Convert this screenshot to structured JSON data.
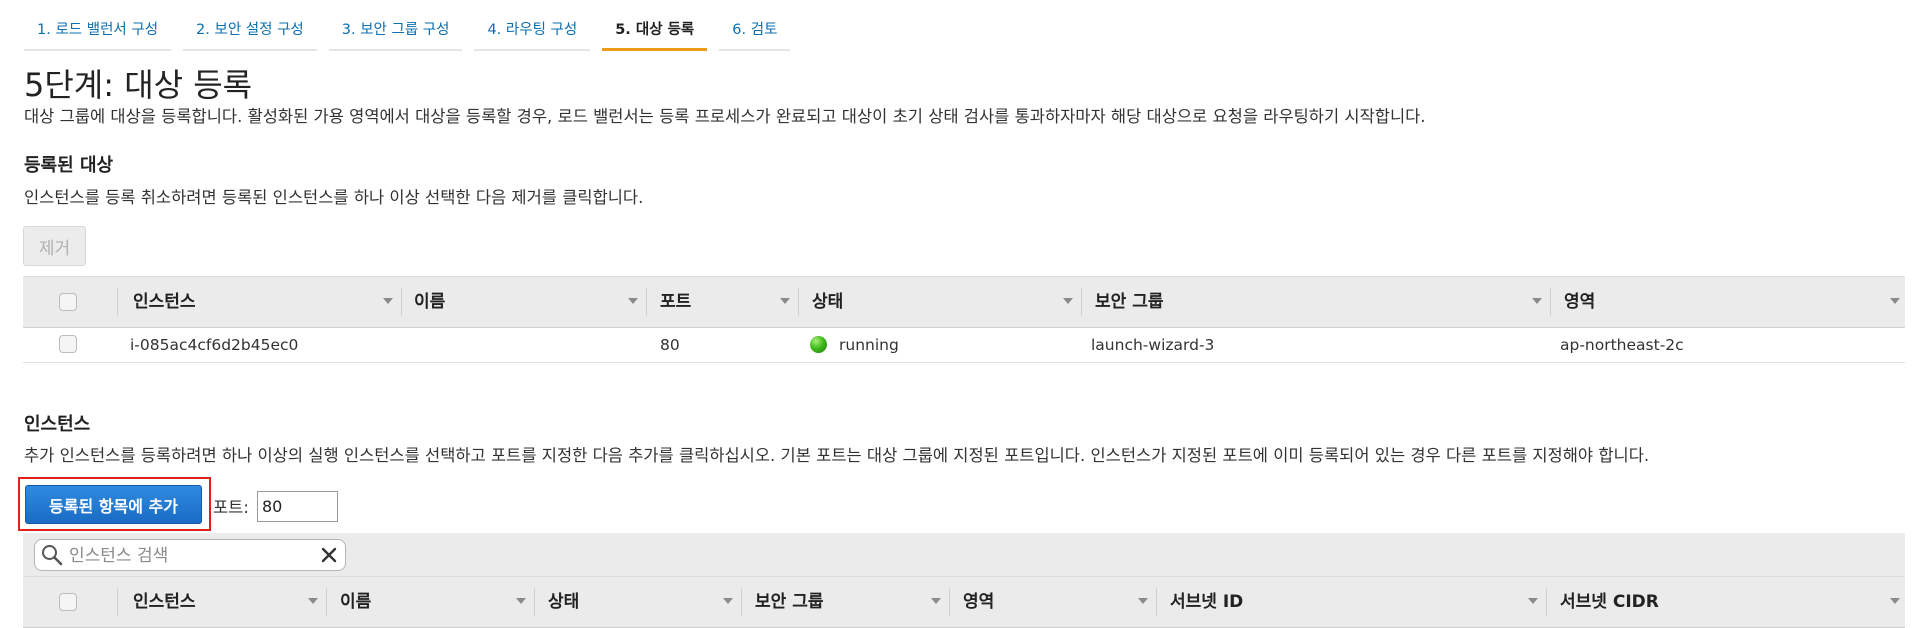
{
  "wizard_tabs": [
    {
      "label": "1. 로드 밸런서 구성",
      "active": false
    },
    {
      "label": "2. 보안 설정 구성",
      "active": false
    },
    {
      "label": "3. 보안 그룹 구성",
      "active": false
    },
    {
      "label": "4. 라우팅 구성",
      "active": false
    },
    {
      "label": "5. 대상 등록",
      "active": true
    },
    {
      "label": "6. 검토",
      "active": false
    }
  ],
  "page": {
    "title": "5단계: 대상 등록",
    "description": "대상 그룹에 대상을 등록합니다. 활성화된 가용 영역에서 대상을 등록할 경우, 로드 밸런서는 등록 프로세스가 완료되고 대상이 초기 상태 검사를 통과하자마자 해당 대상으로 요청을 라우팅하기 시작합니다."
  },
  "registered": {
    "title": "등록된 대상",
    "description": "인스턴스를 등록 취소하려면 등록된 인스턴스를 하나 이상 선택한 다음 제거를 클릭합니다.",
    "remove_label": "제거",
    "columns": [
      "인스턴스",
      "이름",
      "포트",
      "상태",
      "보안 그룹",
      "영역"
    ],
    "rows": [
      {
        "instance": "i-085ac4cf6d2b45ec0",
        "name": "",
        "port": "80",
        "status": "running",
        "security_group": "launch-wizard-3",
        "zone": "ap-northeast-2c"
      }
    ]
  },
  "instances": {
    "title": "인스턴스",
    "description": "추가 인스턴스를 등록하려면 하나 이상의 실행 인스턴스를 선택하고 포트를 지정한 다음 추가를 클릭하십시오. 기본 포트는 대상 그룹에 지정된 포트입니다. 인스턴스가 지정된 포트에 이미 등록되어 있는 경우 다른 포트를 지정해야 합니다.",
    "add_label": "등록된 항목에 추가",
    "port_label": "포트:",
    "port_value": "80",
    "search_placeholder": "인스턴스 검색",
    "columns": [
      "인스턴스",
      "이름",
      "상태",
      "보안 그룹",
      "영역",
      "서브넷 ID",
      "서브넷 CIDR"
    ]
  },
  "colors": {
    "accent": "#1a6bc4",
    "link": "#0b6fb0",
    "active_tab": "#ec9b16",
    "highlight": "#e0201b",
    "running": "#3fba1d"
  }
}
